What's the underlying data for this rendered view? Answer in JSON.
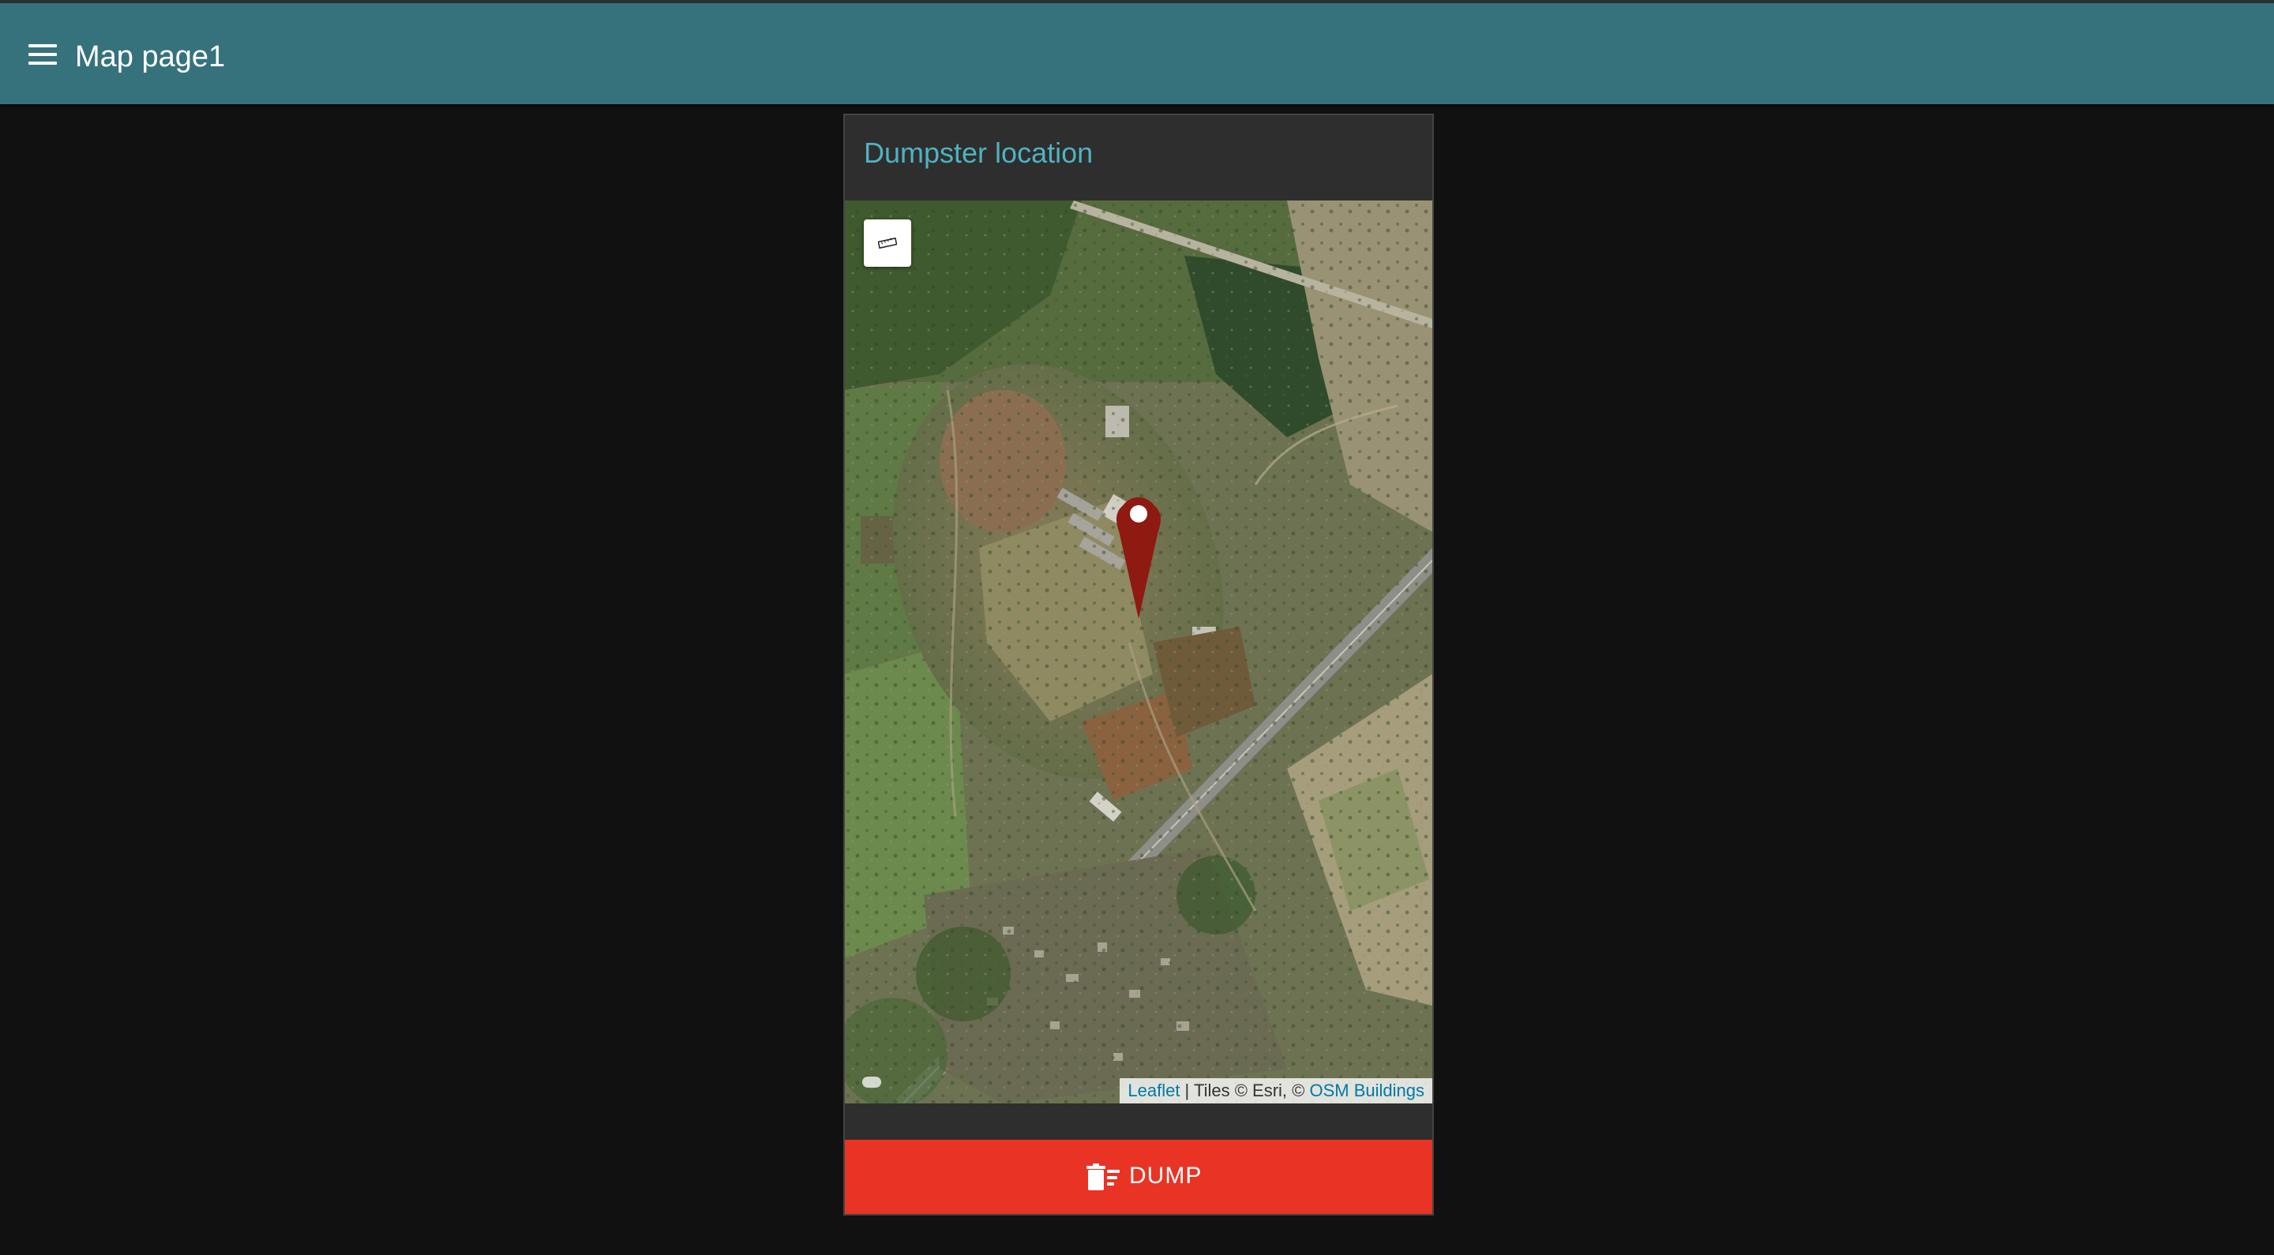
{
  "app_bar": {
    "menu_icon": "hamburger-menu-icon",
    "title": "Map page1",
    "color": "#36727b"
  },
  "card": {
    "title": "Dumpster location",
    "title_color": "#4fb3bf",
    "map": {
      "imagery": "satellite",
      "measure_tool_icon": "ruler-icon",
      "marker_icon": "map-pin-icon",
      "marker_color": "#8e1a12",
      "attribution": {
        "leaflet_link": "Leaflet",
        "separator": " | Tiles © Esri, © ",
        "osm_link": "OSM Buildings"
      }
    },
    "dump_button": {
      "label": "DUMP",
      "icon": "trash-list-icon",
      "color": "#e93324"
    }
  }
}
